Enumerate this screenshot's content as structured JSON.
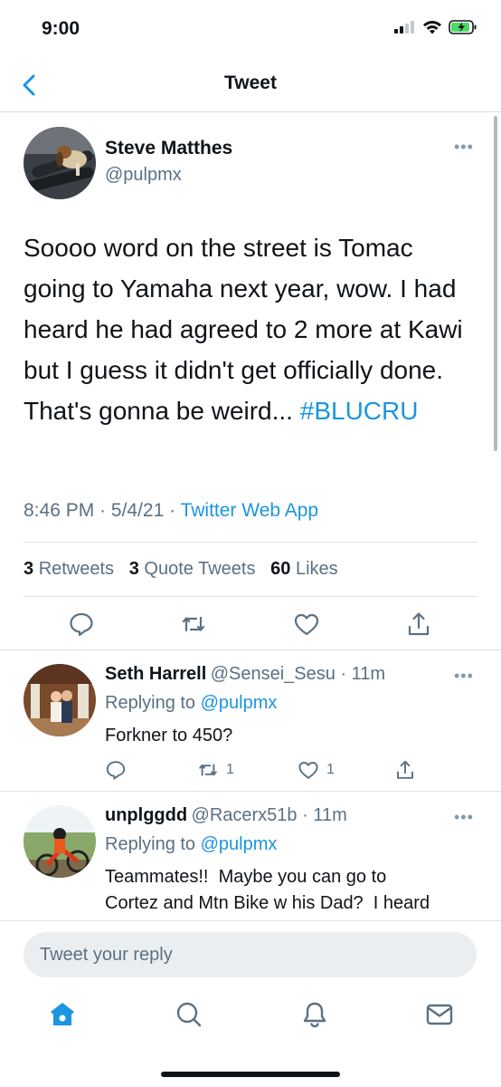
{
  "status_bar": {
    "time": "9:00",
    "icons": [
      "cellular-icon",
      "wifi-icon",
      "battery-charging-icon"
    ]
  },
  "nav": {
    "title": "Tweet",
    "back_icon": "chevron-left-icon"
  },
  "tweet": {
    "name": "Steve Matthes",
    "handle": "@pulpmx",
    "text": "Soooo word on the street is Tomac going to Yamaha next year, wow. I had heard he had agreed to 2 more at Kawi but I guess it didn't get officially done. That's gonna be weird... ",
    "hashtag": "#BLUCRU",
    "time": "8:46 PM",
    "date": "5/4/21",
    "source": "Twitter Web App",
    "sep": " · ",
    "retweets_count": "3",
    "retweets_label": "Retweets",
    "quotes_count": "3",
    "quotes_label": "Quote Tweets",
    "likes_count": "60",
    "likes_label": "Likes",
    "more": "•••"
  },
  "replies": [
    {
      "name": "Seth Harrell",
      "handle": "@Sensei_Sesu",
      "time": " · 11m",
      "replying_label": "Replying to ",
      "replying_to": "@pulpmx",
      "text": "Forkner to 450?",
      "retweets": "1",
      "likes": "1",
      "more": "•••"
    },
    {
      "name": "unplggdd",
      "handle": "@Racerx51b",
      "time": " · 11m",
      "replying_label": "Replying to ",
      "replying_to": "@pulpmx",
      "text_line1": "Teammates!!  Maybe you can go to",
      "text_line2": "Cortez and Mtn Bike w his Dad?  I heard",
      "more": "•••"
    }
  ],
  "composer": {
    "placeholder": "Tweet your reply"
  },
  "tabbar": {
    "icons": [
      "home-icon",
      "search-icon",
      "notifications-icon",
      "messages-icon"
    ]
  },
  "colors": {
    "accent": "#1b95e0",
    "text": "#0f1419",
    "secondary": "#5b7083",
    "divider": "#dde1e4"
  }
}
